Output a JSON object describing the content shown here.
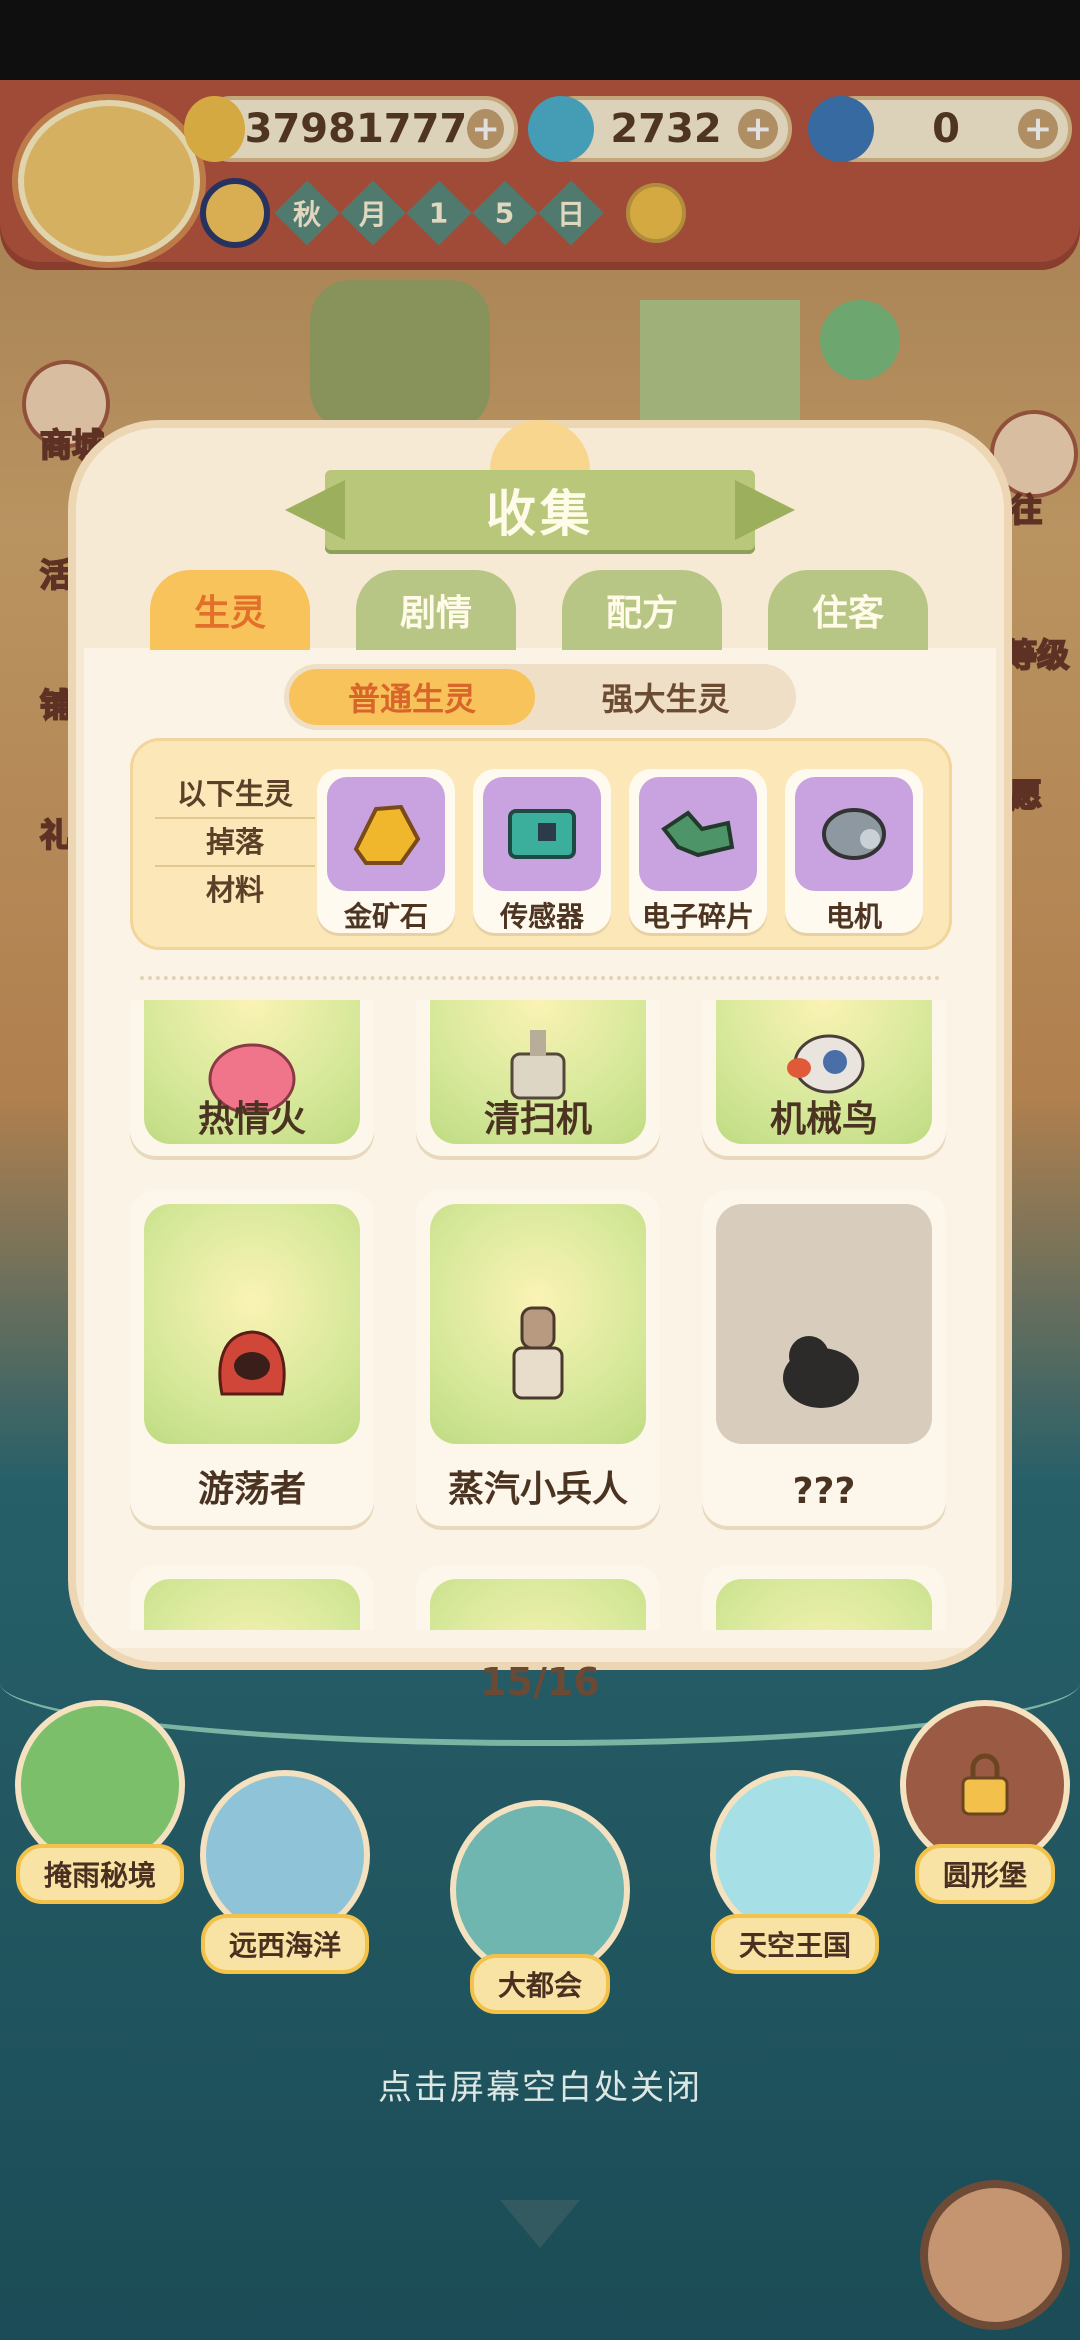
{
  "resources": {
    "banana": {
      "value": "37981777",
      "icon": "banana-icon"
    },
    "blue_flame": {
      "value": "2732",
      "icon": "blue-flame-icon"
    },
    "blue_banana": {
      "value": "0",
      "icon": "blue-banana-icon"
    }
  },
  "date": {
    "chars": [
      "秋",
      "月",
      "1",
      "5",
      "日"
    ]
  },
  "side_menu": {
    "shop": "商城",
    "left2": "活",
    "left3": "铺",
    "left4": "礼",
    "right1": "往",
    "right2": "等级",
    "right3": "愿"
  },
  "panel": {
    "title": "收集",
    "tabs": [
      "生灵",
      "剧情",
      "配方",
      "住客"
    ],
    "active_tab": "生灵",
    "subtabs": {
      "active": "普通生灵",
      "inactive": "强大生灵"
    },
    "drop_label": [
      "以下生灵",
      "掉落",
      "材料"
    ],
    "drops": [
      {
        "name": "金矿石",
        "icon": "gold-ore-icon"
      },
      {
        "name": "传感器",
        "icon": "sensor-chip-icon"
      },
      {
        "name": "电子碎片",
        "icon": "electronic-scrap-icon"
      },
      {
        "name": "电机",
        "icon": "motor-icon"
      }
    ],
    "creatures_row1": [
      "热情火",
      "清扫机",
      "机械鸟"
    ],
    "creatures_row2": [
      "游荡者",
      "蒸汽小兵人",
      "???"
    ],
    "page_counter": "15/16"
  },
  "regions": [
    "掩雨秘境",
    "远西海洋",
    "大都会",
    "天空王国",
    "圆形堡"
  ],
  "close_hint": "点击屏幕空白处关闭",
  "colors": {
    "accent": "#f7c35a",
    "tab_inactive": "#b7c585",
    "title_banner": "#b8c77a"
  }
}
